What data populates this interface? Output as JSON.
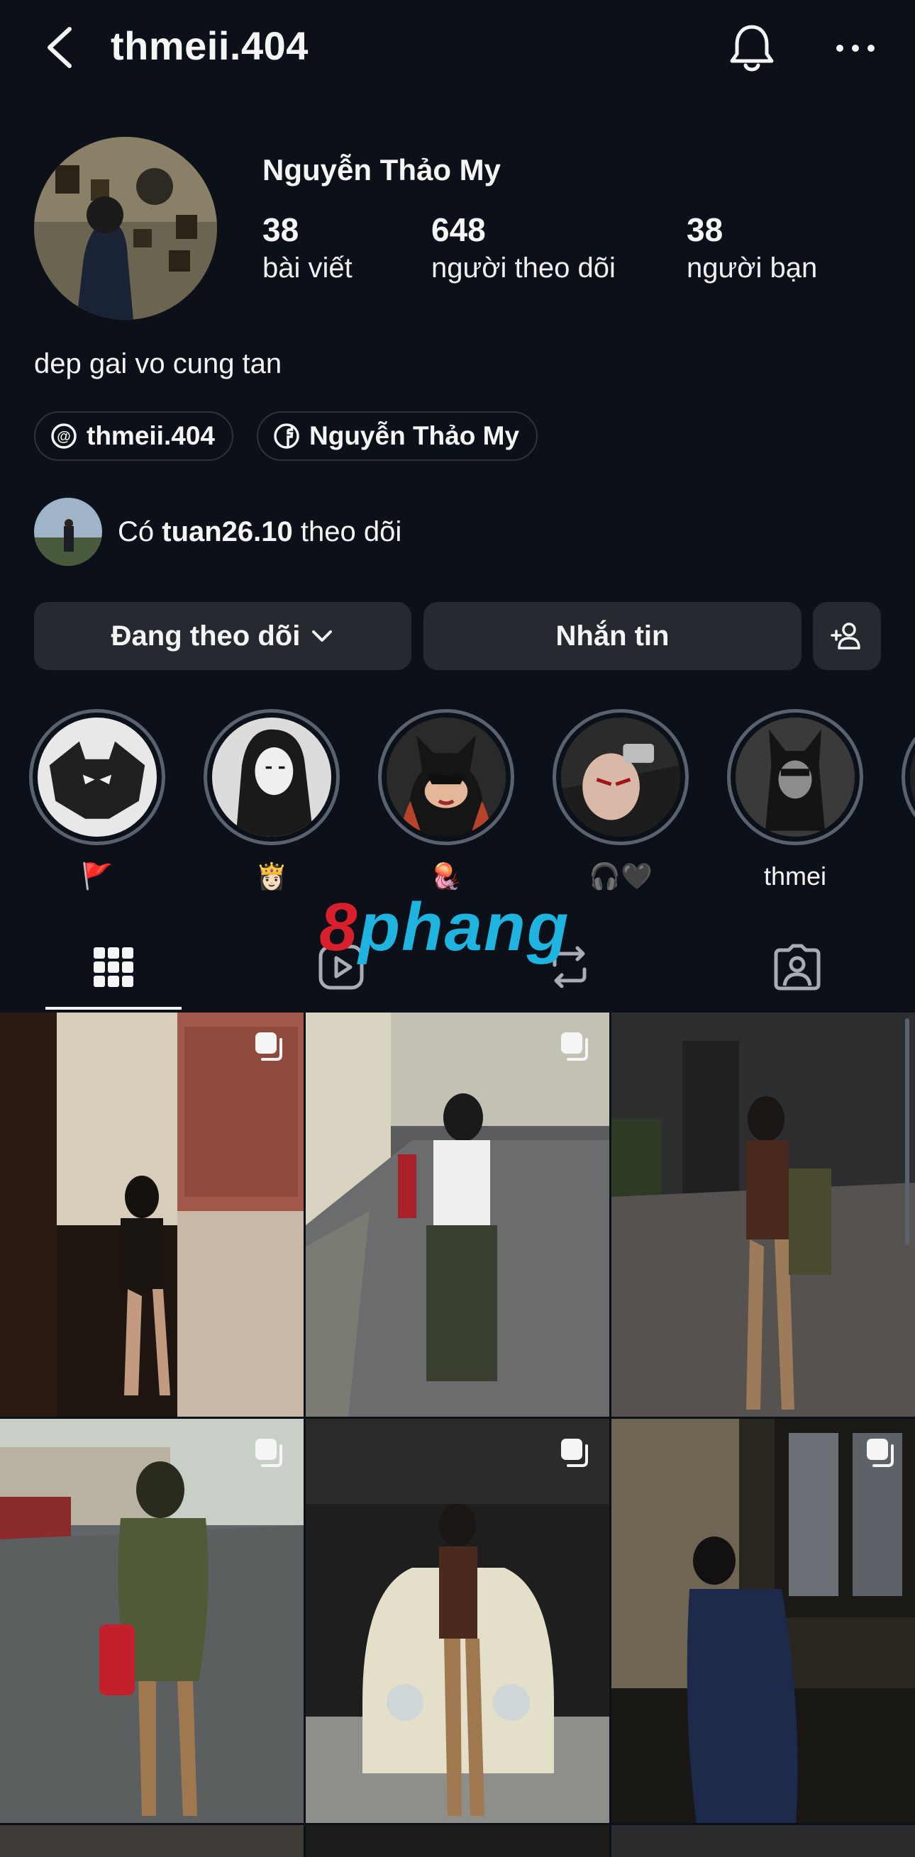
{
  "header": {
    "username": "thmeii.404",
    "back_icon": "chevron-left-icon",
    "bell_icon": "bell-icon",
    "more_icon": "more-horizontal-icon"
  },
  "profile": {
    "full_name": "Nguyễn Thảo My",
    "stats": [
      {
        "value": "38",
        "label": "bài viết"
      },
      {
        "value": "648",
        "label": "người theo dõi"
      },
      {
        "value": "38",
        "label": "người bạn"
      }
    ],
    "bio": "dep gai vo cung tan",
    "links": [
      {
        "icon": "threads-icon",
        "label": "thmeii.404"
      },
      {
        "icon": "facebook-icon",
        "label": "Nguyễn Thảo My"
      }
    ],
    "followed_by": {
      "prefix": "Có ",
      "user": "tuan26.10",
      "suffix": " theo dõi"
    }
  },
  "actions": {
    "following_label": "Đang theo dõi",
    "message_label": "Nhắn tin",
    "add_person_icon": "person-add-icon"
  },
  "highlights": [
    {
      "label": "🚩"
    },
    {
      "label": "👸🏻"
    },
    {
      "label": "🪼"
    },
    {
      "label": "🎧🖤"
    },
    {
      "label": "thmei"
    }
  ],
  "watermark": {
    "part1": "8",
    "part2": "phang"
  },
  "tabs": [
    {
      "name": "posts",
      "icon": "grid-icon",
      "active": true
    },
    {
      "name": "reels",
      "icon": "reels-icon",
      "active": false
    },
    {
      "name": "reposts",
      "icon": "repost-icon",
      "active": false
    },
    {
      "name": "tagged",
      "icon": "tagged-person-icon",
      "active": false
    }
  ],
  "colors": {
    "background": "#0c1119",
    "button": "#252a31",
    "text": "#f5f5f5",
    "ring": "#5a6270",
    "watermark_red": "#d7202b",
    "watermark_blue": "#1fb3df"
  }
}
